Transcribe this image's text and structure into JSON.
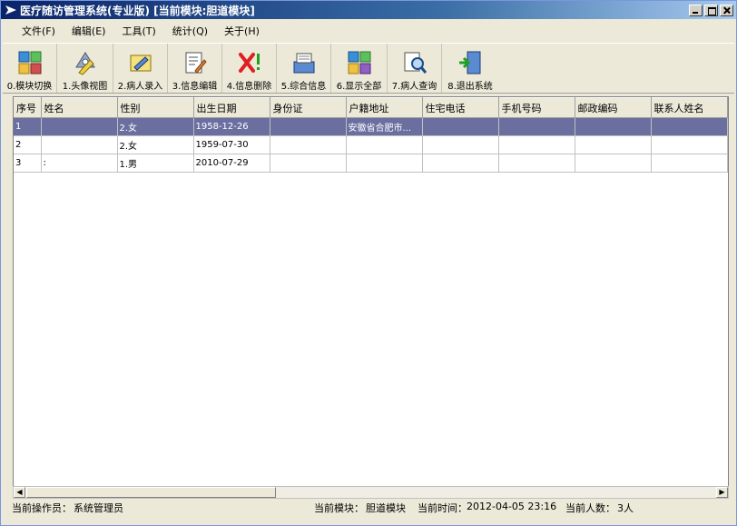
{
  "window": {
    "title": "医疗随访管理系统(专业版) [当前模块:胆道模块]"
  },
  "menu": [
    {
      "label": "文件(F)"
    },
    {
      "label": "编辑(E)"
    },
    {
      "label": "工具(T)"
    },
    {
      "label": "统计(Q)"
    },
    {
      "label": "关于(H)"
    }
  ],
  "toolbar": [
    {
      "label": "0.模块切换",
      "icon": "module-switch-icon"
    },
    {
      "label": "1.头像视图",
      "icon": "avatar-view-icon"
    },
    {
      "label": "2.病人录入",
      "icon": "patient-entry-icon"
    },
    {
      "label": "3.信息编辑",
      "icon": "info-edit-icon"
    },
    {
      "label": "4.信息删除",
      "icon": "info-delete-icon"
    },
    {
      "label": "5.综合信息",
      "icon": "summary-info-icon"
    },
    {
      "label": "6.显示全部",
      "icon": "show-all-icon"
    },
    {
      "label": "7.病人查询",
      "icon": "patient-search-icon"
    },
    {
      "label": "8.退出系统",
      "icon": "exit-icon"
    }
  ],
  "table": {
    "headers": [
      "序号",
      "姓名",
      "性别",
      "出生日期",
      "身份证",
      "户籍地址",
      "住宅电话",
      "手机号码",
      "邮政编码",
      "联系人姓名"
    ],
    "rows": [
      [
        "1",
        "",
        "2.女",
        "1958-12-26",
        "",
        "安徽省合肥市...",
        "",
        "",
        "",
        ""
      ],
      [
        "2",
        "",
        "2.女",
        "1959-07-30",
        "",
        "",
        "",
        "",
        "",
        ""
      ],
      [
        "3",
        ":",
        "1.男",
        "2010-07-29",
        "",
        "",
        "",
        "",
        "",
        ""
      ]
    ],
    "selected_row": 0
  },
  "status": {
    "operator_label": "当前操作员：",
    "operator_value": "系统管理员",
    "module_label": "当前模块：",
    "module_value": "胆道模块",
    "time_label": "当前时间：",
    "time_value": "2012-04-05 23:16",
    "count_label": "当前人数：",
    "count_value": "3人"
  },
  "colors": {
    "selected_row": "#6a6fa0",
    "titlebar_start": "#0a246a",
    "titlebar_end": "#a6caf0"
  }
}
